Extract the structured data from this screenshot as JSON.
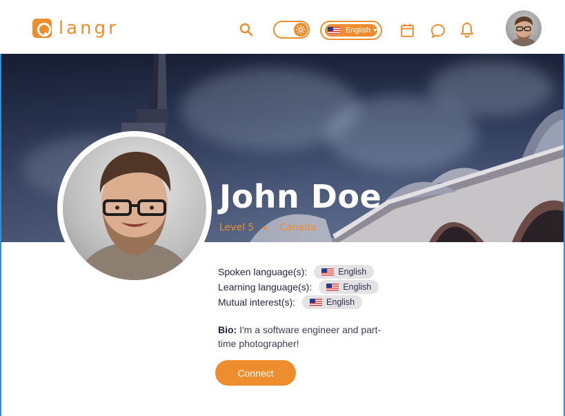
{
  "app": {
    "logo_text": "langr",
    "brand_color": "#ee8d2e"
  },
  "header": {
    "language_select": {
      "selected": "English"
    },
    "icons": [
      "search-icon",
      "sun-icon",
      "calendar-icon",
      "chat-icon",
      "bell-icon"
    ],
    "theme_toggle": {
      "state": "light"
    }
  },
  "profile": {
    "name": "John Doe",
    "level": "Level 5",
    "country": "Canada",
    "spoken_label": "Spoken language(s):",
    "spoken_languages": [
      "English"
    ],
    "learning_label": "Learning language(s):",
    "learning_languages": [
      "English"
    ],
    "mutual_label": "Mutual interest(s):",
    "mutual_interests": [
      "English"
    ],
    "bio_label": "Bio:",
    "bio_text": " I'm a software engineer and part-time photographer!",
    "connect_label": "Connect"
  }
}
